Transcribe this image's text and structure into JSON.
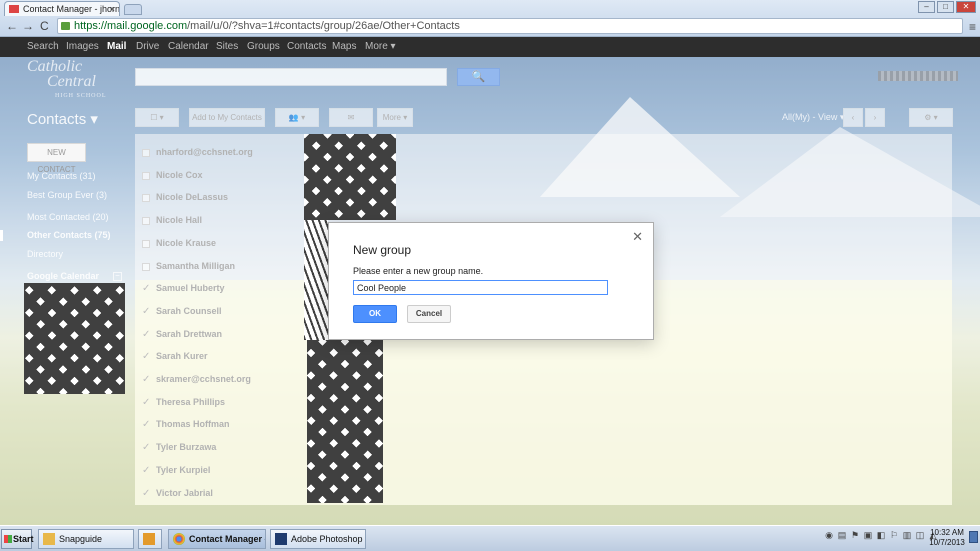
{
  "browser": {
    "tab_title": "Contact Manager - jhorn",
    "tab_close": "×",
    "url_main": "https://mail.google.com",
    "url_rest": "/mail/u/0/?shva=1#contacts/group/26ae/Other+Contacts",
    "back": "←",
    "forward": "→",
    "reload": "C",
    "menu": "≡",
    "window_minimize": "–",
    "window_maximize": "□",
    "window_close": "✕"
  },
  "gbar": [
    "Search",
    "Images",
    "Mail",
    "Drive",
    "Calendar",
    "Sites",
    "Groups",
    "Contacts",
    "Maps",
    "More ▾"
  ],
  "gbar_active": "Mail",
  "logo": {
    "line1": "Catholic",
    "line2": "Central",
    "line3": "HIGH SCHOOL"
  },
  "search_button": "🔍",
  "header": {
    "contacts_title": "Contacts ▾",
    "toolbar": [
      "☐ ▾",
      "Add to My Contacts",
      "👥 ▾",
      "✉",
      "More ▾"
    ],
    "pager": "All(My) - View ▾",
    "prev": "‹",
    "next": "›",
    "settings": "⚙ ▾"
  },
  "sidebar": {
    "new_contact": "NEW CONTACT",
    "items": [
      {
        "label": "My Contacts (31)",
        "bold": false
      },
      {
        "label": "Best Group Ever (3)",
        "bold": false
      },
      {
        "label": "Most Contacted (20)",
        "bold": false
      },
      {
        "label": "Other Contacts (75)",
        "bold": true
      },
      {
        "label": "Directory",
        "bold": false
      }
    ],
    "gcal_title": "Google Calendar",
    "gcal_toggle": "−"
  },
  "contacts": [
    {
      "name": "nharford@cchsnet.org",
      "checked": false
    },
    {
      "name": "Nicole Cox",
      "checked": false
    },
    {
      "name": "Nicole DeLassus",
      "checked": false
    },
    {
      "name": "Nicole Hall",
      "checked": false
    },
    {
      "name": "Nicole Krause",
      "checked": false
    },
    {
      "name": "Samantha Milligan",
      "checked": false
    },
    {
      "name": "Samuel Huberty",
      "checked": true
    },
    {
      "name": "Sarah Counsell",
      "checked": true
    },
    {
      "name": "Sarah Drettwan",
      "checked": true
    },
    {
      "name": "Sarah Kurer",
      "checked": true
    },
    {
      "name": "skramer@cchsnet.org",
      "checked": true
    },
    {
      "name": "Theresa Phillips",
      "checked": true
    },
    {
      "name": "Thomas Hoffman",
      "checked": true
    },
    {
      "name": "Tyler Burzawa",
      "checked": true
    },
    {
      "name": "Tyler Kurpiel",
      "checked": true
    },
    {
      "name": "Victor Jabrial",
      "checked": true
    }
  ],
  "checkmark": "✓",
  "dialog": {
    "title": "New group",
    "prompt": "Please enter a new group name.",
    "input_value": "Cool People",
    "ok_label": "OK",
    "cancel_label": "Cancel",
    "close": "✕"
  },
  "taskbar": {
    "start": "Start",
    "tasks": [
      {
        "label": "Snapguide",
        "active": false
      },
      {
        "label": "",
        "active": false
      },
      {
        "label": "Contact Manager - ...",
        "active": true
      },
      {
        "label": "Adobe Photoshop C...",
        "active": false
      }
    ],
    "clock_time": "10:32 AM",
    "clock_date": "10/7/2013"
  },
  "colors": {
    "accent": "#4d90fe",
    "gbar": "#2d2d2d"
  }
}
